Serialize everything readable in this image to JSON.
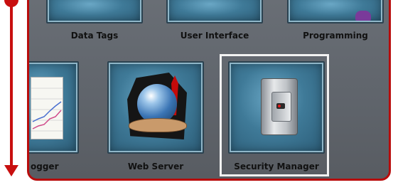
{
  "tiles_top": [
    {
      "label": "Data Tags"
    },
    {
      "label": "User Interface"
    },
    {
      "label": "Programming"
    }
  ],
  "tiles_bottom": [
    {
      "label": "ogger"
    },
    {
      "label": "Web Server"
    },
    {
      "label": "Security Manager"
    }
  ],
  "colors": {
    "accent": "#c80f0f",
    "panel": "#62666d",
    "tile": "#3f7a98",
    "selection": "#f2f2f2"
  },
  "icons": [
    "line-chart-icon",
    "globe-hands-icon",
    "safe-icon",
    "scroll-down-arrow-icon"
  ]
}
